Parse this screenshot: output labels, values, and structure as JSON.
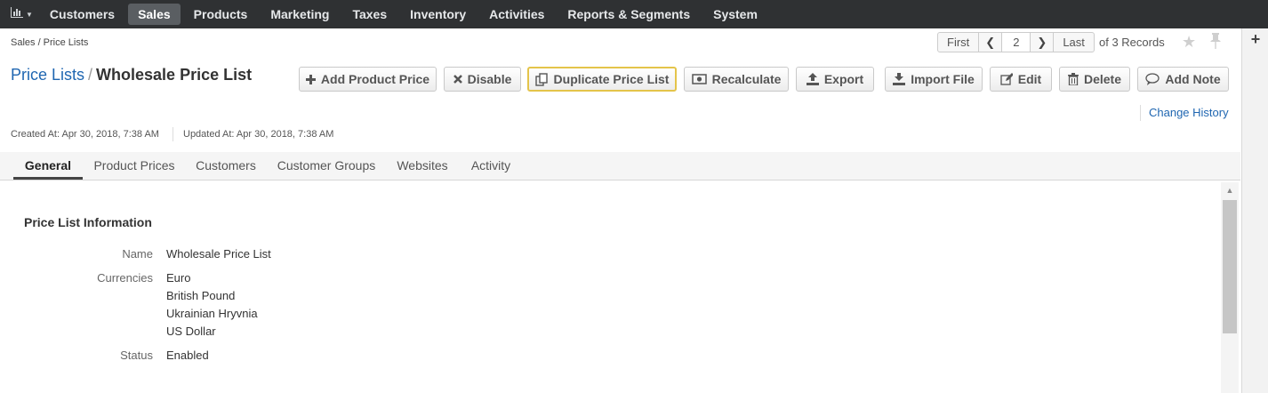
{
  "topnav": {
    "dashboard_icon": "bar-chart-icon",
    "items": [
      {
        "label": "Customers"
      },
      {
        "label": "Sales",
        "active": true
      },
      {
        "label": "Products"
      },
      {
        "label": "Marketing"
      },
      {
        "label": "Taxes"
      },
      {
        "label": "Inventory"
      },
      {
        "label": "Activities"
      },
      {
        "label": "Reports & Segments"
      },
      {
        "label": "System"
      }
    ]
  },
  "breadcrumb": "Sales / Price Lists",
  "pager": {
    "first": "First",
    "current": "2",
    "last": "Last",
    "records": "of 3 Records"
  },
  "title": {
    "parent": "Price Lists",
    "separator": "/",
    "current": "Wholesale Price List"
  },
  "actions": {
    "add_product_price": "Add Product Price",
    "disable": "Disable",
    "duplicate": "Duplicate Price List",
    "recalculate": "Recalculate",
    "export": "Export",
    "import_file": "Import File",
    "edit": "Edit",
    "delete": "Delete",
    "add_note": "Add Note"
  },
  "change_history": "Change History",
  "meta": {
    "created": "Created At: Apr 30, 2018, 7:38 AM",
    "updated": "Updated At: Apr 30, 2018, 7:38 AM"
  },
  "tabs": [
    {
      "label": "General",
      "active": true
    },
    {
      "label": "Product Prices"
    },
    {
      "label": "Customers"
    },
    {
      "label": "Customer Groups"
    },
    {
      "label": "Websites"
    },
    {
      "label": "Activity"
    }
  ],
  "section": {
    "title": "Price List Information",
    "name_label": "Name",
    "name_value": "Wholesale Price List",
    "currencies_label": "Currencies",
    "currencies": [
      "Euro",
      "British Pound",
      "Ukrainian Hryvnia",
      "US Dollar"
    ],
    "status_label": "Status",
    "status_value": "Enabled"
  },
  "colors": {
    "nav_bg": "#2f3133",
    "link": "#1f66b1",
    "focus_border": "#e4c44a"
  }
}
